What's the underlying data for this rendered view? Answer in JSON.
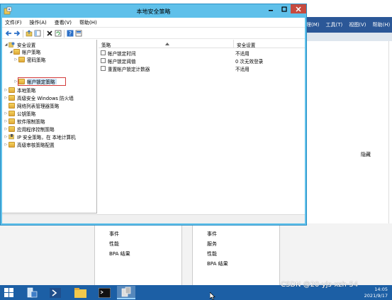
{
  "window": {
    "title": "本地安全策略",
    "menu": [
      "文件(F)",
      "操作(A)",
      "查看(V)",
      "帮助(H)"
    ]
  },
  "tree": {
    "root": "安全设置",
    "children": [
      {
        "label": "帐户策略",
        "expanded": true
      },
      {
        "label": "密码策略"
      },
      {
        "label": "帐户锁定策略",
        "selected": true
      },
      {
        "label": "本地策略"
      },
      {
        "label": "高级安全 Windows 防火墙"
      },
      {
        "label": "网络列表管理器策略"
      },
      {
        "label": "公钥策略"
      },
      {
        "label": "软件限制策略"
      },
      {
        "label": "应用程序控制策略"
      },
      {
        "label": "IP 安全策略，在 本地计算机"
      },
      {
        "label": "高级审核策略配置"
      }
    ]
  },
  "list": {
    "col_policy": "策略",
    "col_setting": "安全设置",
    "rows": [
      {
        "policy": "帐户锁定时间",
        "setting": "不适用"
      },
      {
        "policy": "帐户锁定阈值",
        "setting": "0 次无效登录"
      },
      {
        "policy": "重置帐户锁定计数器",
        "setting": "不适用"
      }
    ]
  },
  "background": {
    "menu": [
      "理(M)",
      "工具(T)",
      "视图(V)",
      "帮助(H)"
    ],
    "hide": "隐藏",
    "tile1": [
      "事件",
      "性能",
      "BPA 结果"
    ],
    "tile2": [
      "事件",
      "服务",
      "性能",
      "BPA 结果"
    ]
  },
  "taskbar": {
    "time": "14:05",
    "date": "2021/9/17",
    "watermark": "CSDN @20-yjs-xzh-54"
  },
  "colors": {
    "title_bar": "#5fc0ea",
    "close_button": "#c74a3f",
    "taskbar": "#1c5fa5",
    "selection_highlight": "#d23b3b"
  }
}
